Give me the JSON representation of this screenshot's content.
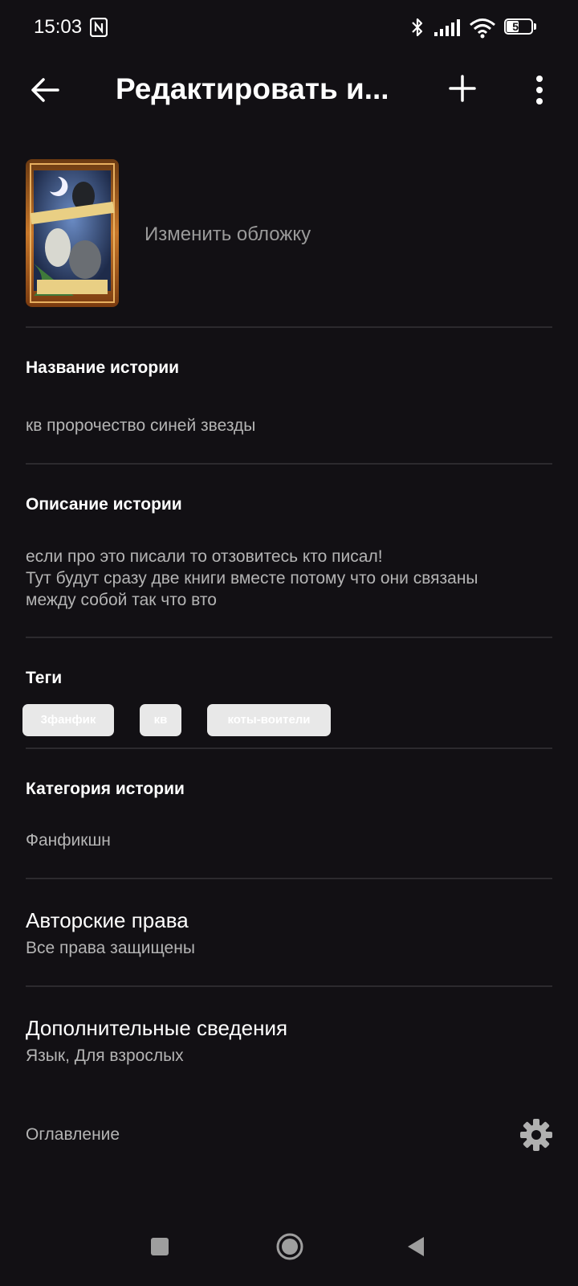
{
  "status_bar": {
    "time": "15:03",
    "battery_level": "51",
    "icons": [
      "nfc-icon",
      "bluetooth-icon",
      "signal-icon",
      "wifi-icon",
      "battery-icon"
    ]
  },
  "app_bar": {
    "title": "Редактировать и...",
    "icons": [
      "back-arrow-icon",
      "plus-icon",
      "more-vert-icon"
    ]
  },
  "cover": {
    "change_label": "Изменить обложку",
    "book_title_art": "Коты-Воители",
    "book_subtitle_art": "Начало",
    "author_art": "Эрин Хантер"
  },
  "story": {
    "title_label": "Название истории",
    "title_value": "кв пророчество синей звезды",
    "description_label": "Описание истории",
    "description_lines": [
      "если про это писали то отзовитесь кто писал!",
      "Тут будут сразу две книги вместе потому что они связаны",
      "между собой так что вто"
    ],
    "tags_label": "Теги",
    "tags": [
      "3фанфик",
      "кв",
      "коты-воители"
    ],
    "category_label": "Категория истории",
    "category_value": "Фанфикшн"
  },
  "copyright": {
    "title": "Авторские права",
    "value": "Все права защищены"
  },
  "details": {
    "title": "Дополнительные сведения",
    "value": "Язык, Для взрослых"
  },
  "toc": {
    "label": "Оглавление",
    "icon": "gear-icon"
  },
  "nav_bar": {
    "icons": [
      "recents-square-icon",
      "home-circle-icon",
      "back-triangle-icon"
    ]
  },
  "colors": {
    "background": "#121014",
    "divider": "#2c2a2e",
    "secondary_text": "#b4b4b4",
    "tag_background": "#e8e8e8"
  }
}
